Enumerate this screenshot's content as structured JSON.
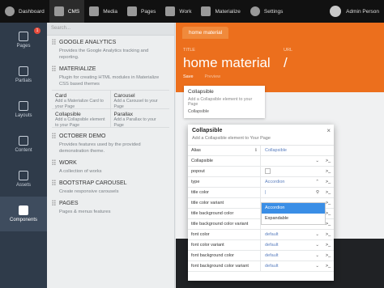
{
  "topbar": {
    "dashboard": "Dashboard",
    "cms": "CMS",
    "media": "Media",
    "pages": "Pages",
    "work": "Work",
    "materialize": "Materialize",
    "settings": "Settings",
    "user": "Admin Person"
  },
  "leftnav": {
    "pages": "Pages",
    "pages_badge": "1",
    "partials": "Partials",
    "layouts": "Layouts",
    "content": "Content",
    "assets": "Assets",
    "components": "Components"
  },
  "panel": {
    "search_placeholder": "Search...",
    "sections": [
      {
        "title": "GOOGLE ANALYTICS",
        "desc": "Provides the Google Analytics tracking and reporting."
      },
      {
        "title": "MATERIALIZE",
        "desc": "Plugin for creating HTML modules in Materialize CSS based themes"
      },
      {
        "title": "OCTOBER DEMO",
        "desc": "Provides features used by the provided demonstration theme."
      },
      {
        "title": "WORK",
        "desc": "A collection of works"
      },
      {
        "title": "BOOTSTRAP CAROUSEL",
        "desc": "Create responsive carousels"
      },
      {
        "title": "PAGES",
        "desc": "Pages & menus features"
      }
    ],
    "materialize_items": [
      {
        "title": "Card",
        "desc": "Add a Materialize Card to your Page"
      },
      {
        "title": "Carousel",
        "desc": "Add a Carousel to your Page"
      },
      {
        "title": "Collapsible",
        "desc": "Add a Collapsible element to your Page"
      },
      {
        "title": "Parallax",
        "desc": "Add a Parallax to your Page"
      }
    ]
  },
  "editor": {
    "tab": "home material",
    "title_label": "TITLE",
    "url_label": "URL",
    "title_value": "home material",
    "url_value": "/",
    "save": "Save",
    "preview": "Preview"
  },
  "tooltip": {
    "title": "Collapsible",
    "desc": "Add a Collapsible element to your Page",
    "sub": "Collapsible"
  },
  "dialog": {
    "title": "Collapsible",
    "subtitle": "Add a Collapsible element to Your Page",
    "rows": [
      {
        "key": "Alias",
        "value": "Collapsible"
      },
      {
        "key": "Collapsible",
        "value": ""
      },
      {
        "key": "popout",
        "value": ""
      },
      {
        "key": "type",
        "value": "Accordion"
      },
      {
        "key": "title color",
        "value": ""
      },
      {
        "key": "title color variant",
        "value": ""
      },
      {
        "key": "title background color",
        "value": ""
      },
      {
        "key": "title background color variant",
        "value": "default"
      },
      {
        "key": "font color",
        "value": "default"
      },
      {
        "key": "font color variant",
        "value": "default"
      },
      {
        "key": "font background color",
        "value": "default"
      },
      {
        "key": "font background color variant",
        "value": "default"
      }
    ],
    "dropdown_options": [
      "Accordion",
      "Expandable"
    ]
  }
}
